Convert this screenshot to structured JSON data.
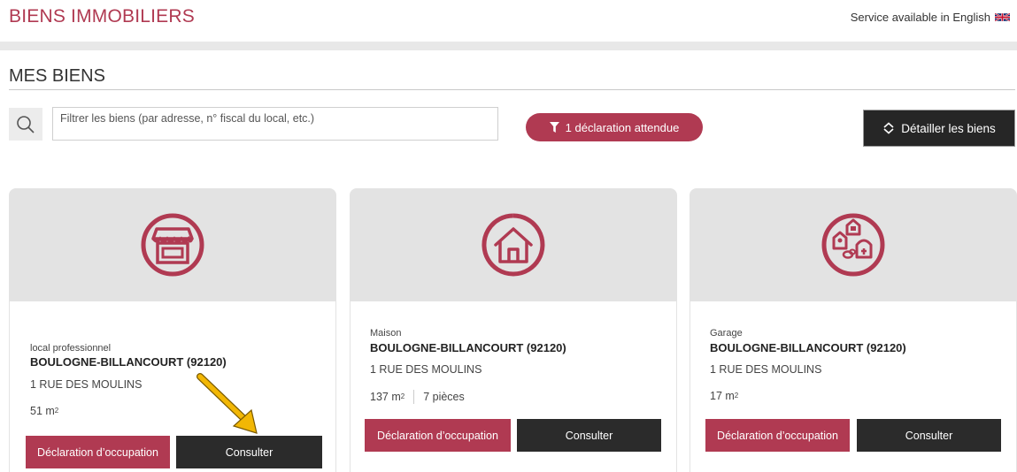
{
  "header": {
    "title": "BIENS IMMOBILIERS",
    "language_link": "Service available in English",
    "flag_icon": "uk-flag-icon"
  },
  "section": {
    "title": "MES BIENS"
  },
  "toolbar": {
    "search_placeholder": "Filtrer les biens (par adresse, n° fiscal du local, etc.)",
    "search_icon": "search-icon",
    "pending_label": "1 déclaration attendue",
    "pending_icon": "filter-icon",
    "detail_label": "Détailler les biens",
    "detail_icon": "expand-collapse-icon"
  },
  "colors": {
    "accent": "#b03a52",
    "dark": "#2b2b2b",
    "banner": "#e3e3e3"
  },
  "properties": [
    {
      "type": "local professionnel",
      "icon": "shop-icon",
      "city": "BOULOGNE-BILLANCOURT (92120)",
      "street": "1 RUE DES MOULINS",
      "area": "51 m",
      "area_unit_sup": "2",
      "rooms": "",
      "declare_label": "Déclaration d’occupation",
      "consult_label": "Consulter"
    },
    {
      "type": "Maison",
      "icon": "house-icon",
      "city": "BOULOGNE-BILLANCOURT (92120)",
      "street": "1 RUE DES MOULINS",
      "area": "137 m",
      "area_unit_sup": "2",
      "rooms": "7 pièces",
      "declare_label": "Déclaration d’occupation",
      "consult_label": "Consulter"
    },
    {
      "type": "Garage",
      "icon": "garage-outbuildings-icon",
      "city": "BOULOGNE-BILLANCOURT (92120)",
      "street": "1 RUE DES MOULINS",
      "area": "17 m",
      "area_unit_sup": "2",
      "rooms": "",
      "declare_label": "Déclaration d’occupation",
      "consult_label": "Consulter"
    }
  ],
  "annotation": {
    "icon": "yellow-arrow-icon",
    "color": "#f2b705"
  }
}
